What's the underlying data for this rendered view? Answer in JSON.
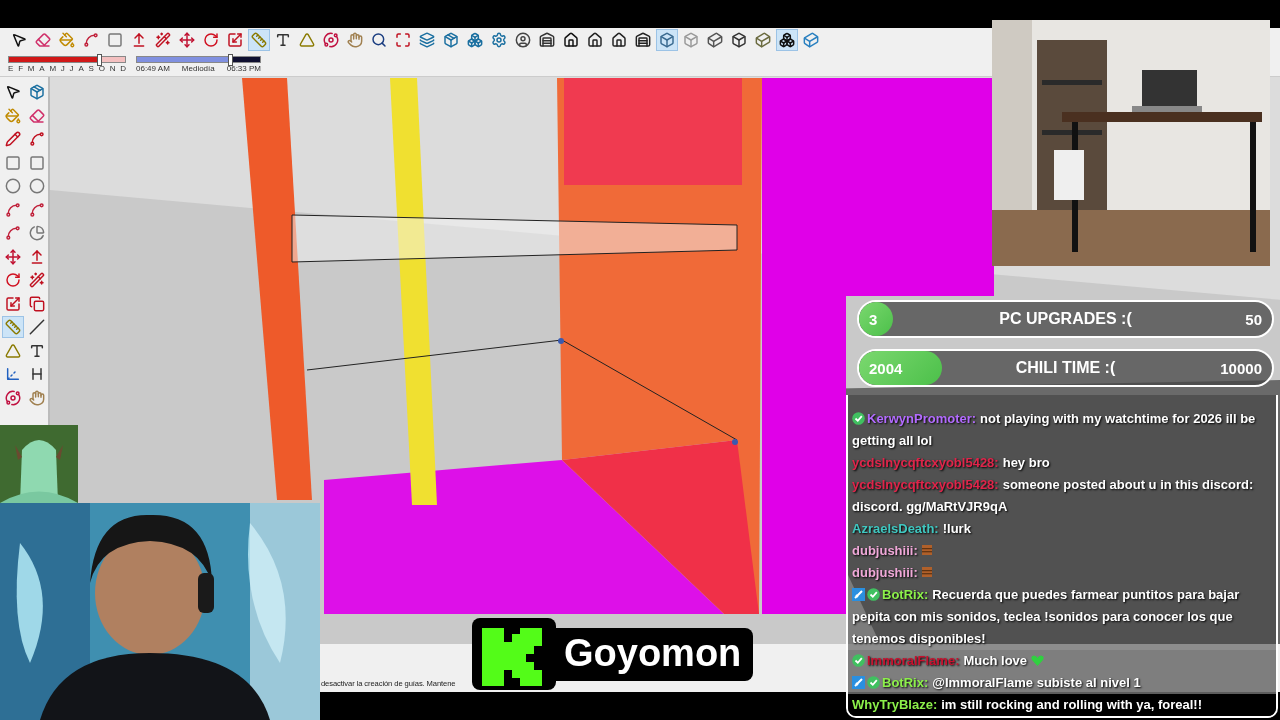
{
  "toolbar": {
    "tools": [
      {
        "kind": "select",
        "selected": false
      },
      {
        "kind": "eraser",
        "selected": false
      },
      {
        "kind": "paint",
        "selected": false
      },
      {
        "kind": "arc",
        "selected": false
      },
      {
        "kind": "rect",
        "selected": false
      },
      {
        "kind": "push",
        "selected": false
      },
      {
        "kind": "follow",
        "selected": false
      },
      {
        "kind": "move",
        "selected": false
      },
      {
        "kind": "rotate",
        "selected": false
      },
      {
        "kind": "scale",
        "selected": false
      },
      {
        "kind": "tape",
        "selected": true
      },
      {
        "kind": "text",
        "selected": false
      },
      {
        "kind": "protractor",
        "selected": false
      },
      {
        "kind": "orbit",
        "selected": false
      },
      {
        "kind": "pan",
        "selected": false
      },
      {
        "kind": "zoom",
        "selected": false
      },
      {
        "kind": "extents",
        "selected": false
      },
      {
        "kind": "layers",
        "selected": false
      },
      {
        "kind": "components",
        "selected": false
      },
      {
        "kind": "stack",
        "selected": false
      },
      {
        "kind": "settings",
        "selected": false
      },
      {
        "kind": "user",
        "selected": false
      },
      {
        "kind": "iso",
        "selected": false
      },
      {
        "kind": "home",
        "selected": false
      },
      {
        "kind": "top",
        "selected": false
      },
      {
        "kind": "front",
        "selected": false
      },
      {
        "kind": "back",
        "selected": false
      },
      {
        "kind": "xray",
        "selected": true
      },
      {
        "kind": "backedges",
        "selected": false
      },
      {
        "kind": "wire",
        "selected": false
      },
      {
        "kind": "hidden",
        "selected": false
      },
      {
        "kind": "shaded",
        "selected": false
      },
      {
        "kind": "textured",
        "selected": true
      },
      {
        "kind": "mono",
        "selected": false
      }
    ]
  },
  "shadows": {
    "months": [
      "E",
      "F",
      "M",
      "A",
      "M",
      "J",
      "J",
      "A",
      "S",
      "O",
      "N",
      "D"
    ],
    "month_slider": {
      "level": 0.78
    },
    "times": [
      "06:49 AM",
      "Mediodía",
      "06:33 PM"
    ],
    "time_slider": {
      "level": 0.76
    }
  },
  "side_toolbar": {
    "tools": [
      {
        "kind": "select",
        "selected": false
      },
      {
        "kind": "components",
        "selected": false
      },
      {
        "kind": "paint",
        "selected": false
      },
      {
        "kind": "eraser",
        "selected": false
      },
      {
        "kind": "pencil",
        "selected": false
      },
      {
        "kind": "freehand",
        "selected": false
      },
      {
        "kind": "rect",
        "selected": false
      },
      {
        "kind": "rect",
        "selected": false
      },
      {
        "kind": "circle",
        "selected": false
      },
      {
        "kind": "circle",
        "selected": false
      },
      {
        "kind": "arc",
        "selected": false
      },
      {
        "kind": "arc",
        "selected": false
      },
      {
        "kind": "arc",
        "selected": false
      },
      {
        "kind": "pie",
        "selected": false
      },
      {
        "kind": "move",
        "selected": false
      },
      {
        "kind": "push",
        "selected": false
      },
      {
        "kind": "rotate",
        "selected": false
      },
      {
        "kind": "follow",
        "selected": false
      },
      {
        "kind": "scale",
        "selected": false
      },
      {
        "kind": "offset",
        "selected": false
      },
      {
        "kind": "tape",
        "selected": true
      },
      {
        "kind": "dimension",
        "selected": false
      },
      {
        "kind": "protractor",
        "selected": false
      },
      {
        "kind": "text",
        "selected": false
      },
      {
        "kind": "axes",
        "selected": false
      },
      {
        "kind": "text3d",
        "selected": false
      },
      {
        "kind": "orbit",
        "selected": false
      },
      {
        "kind": "pan",
        "selected": false
      }
    ]
  },
  "status_bar": {
    "text": "desactivar la creación de guías. Mantene"
  },
  "goals": [
    {
      "count": "3",
      "title": "PC UPGRADES :(",
      "target": "50",
      "level": 0.06
    },
    {
      "count": "2004",
      "title": "CHILI TIME :(",
      "target": "10000",
      "level": 0.2
    }
  ],
  "chat": {
    "messages": [
      {
        "kind": "message",
        "user": "KerwynPromoter:",
        "color": "#b36bff",
        "text": "not playing with my watchtime for 2026 ill be getting all lol",
        "verified": true
      },
      {
        "kind": "message",
        "user": "ycdslnycqftcxyobl5428:",
        "color": "#e0244a",
        "text": "hey bro"
      },
      {
        "kind": "message",
        "user": "ycdslnycqftcxyobl5428:",
        "color": "#e0244a",
        "text": "someone posted about u in this discord: discord. gg/MaRtVJR9qA"
      },
      {
        "kind": "message",
        "user": "AzraelsDeath:",
        "color": "#3fc7c0",
        "text": "!lurk"
      },
      {
        "kind": "message",
        "user": "dubjushiii:",
        "color": "#f0a8d8",
        "emote": true
      },
      {
        "kind": "message",
        "user": "dubjushiii:",
        "color": "#f0a8d8",
        "emote": true
      },
      {
        "kind": "message",
        "user": "BotRix:",
        "color": "#8cf04a",
        "text": "Recuerda que puedes farmear puntitos para bajar pepita con mis sonidos, teclea !sonidos para conocer los que tenemos disponibles!",
        "moderator": true,
        "verified": true
      },
      {
        "kind": "notice",
        "user": "ImmoralFlame:",
        "color": "#c8102e",
        "text": "Much love",
        "verified": true,
        "heart": true
      },
      {
        "kind": "notice",
        "user": "BotRix:",
        "color": "#8cf04a",
        "text": "@ImmoralFlame subiste al nivel 1",
        "moderator": true,
        "verified": true
      },
      {
        "kind": "latest",
        "user": "WhyTryBlaze:",
        "color": "#8cf04a",
        "text": "im still rocking and rolling with ya, foreal!!"
      }
    ]
  },
  "streamer": {
    "name": "Goyomon"
  }
}
